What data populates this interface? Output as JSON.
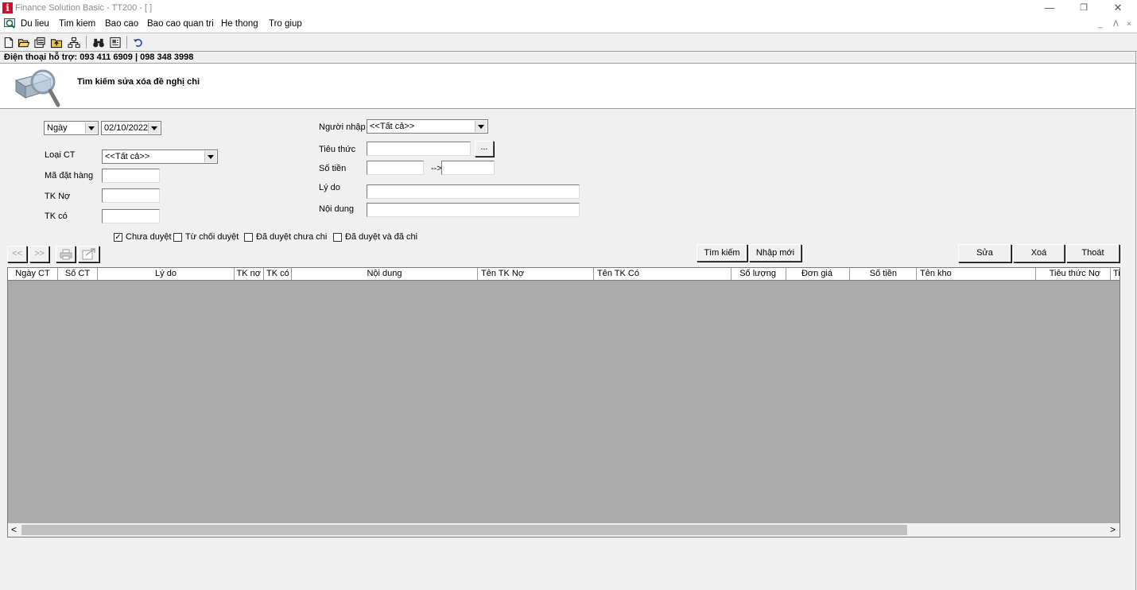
{
  "window": {
    "title": "Finance Solution Basic - TT200 - [ ]",
    "minimize": "—",
    "restore": "❐",
    "close": "✕"
  },
  "menu": {
    "items": [
      "Du lieu",
      "Tim kiem",
      "Bao cao",
      "Bao cao quan tri",
      "He thong",
      "Tro giup"
    ],
    "mdi_controls": [
      "_",
      "ᐱ",
      "×"
    ]
  },
  "toolbar": {
    "icons": [
      "new-document-icon",
      "open-folder-icon",
      "properties-icon",
      "folder-up-icon",
      "network-icon",
      "binoculars-icon",
      "report-icon",
      "undo-icon"
    ]
  },
  "support": {
    "text": "Điện thoại hỗ trợ: 093 411 6909 | 098 348 3998"
  },
  "header": {
    "title": "Tìm kiếm sửa xóa đề nghị chi"
  },
  "form": {
    "date_type": "Ngày",
    "date_value": "02/10/2022",
    "loai_ct_label": "Loại CT",
    "loai_ct_value": "<<Tất cả>>",
    "ma_dat_hang_label": "Mã đặt hàng",
    "tk_no_label": "TK Nợ",
    "tk_co_label": "TK có",
    "nguoi_nhap_label": "Người nhập",
    "nguoi_nhap_value": "<<Tất cả>>",
    "tieu_thuc_label": "Tiêu thức",
    "tieu_thuc_button": "...",
    "so_tien_label": "Số tiền",
    "so_tien_arrow": "-->",
    "ly_do_label": "Lý do",
    "noi_dung_label": "Nội dung"
  },
  "filters": [
    {
      "label": "Chưa duyệt",
      "checked": true
    },
    {
      "label": "Từ chối duyệt",
      "checked": false
    },
    {
      "label": "Đã duyệt chưa chi",
      "checked": false
    },
    {
      "label": "Đã duyệt và đã chi",
      "checked": false
    }
  ],
  "buttons": {
    "prev": "<<",
    "next": ">>",
    "print_icon": "printer-icon",
    "export_icon": "export-icon",
    "search": "Tìm kiếm",
    "new": "Nhập mới",
    "edit": "Sửa",
    "delete": "Xoá",
    "exit": "Thoát"
  },
  "grid": {
    "columns": [
      "Ngày CT",
      "Số CT",
      "Lý do",
      "TK nợ",
      "TK có",
      "Nội dung",
      "Tên TK Nợ",
      "Tên TK Có",
      "Số lượng",
      "Đơn giá",
      "Số tiền",
      "Tên kho",
      "Tiêu thức Nợ",
      "Ti"
    ],
    "rows": [],
    "scroll_left": "<",
    "scroll_right": ">"
  }
}
